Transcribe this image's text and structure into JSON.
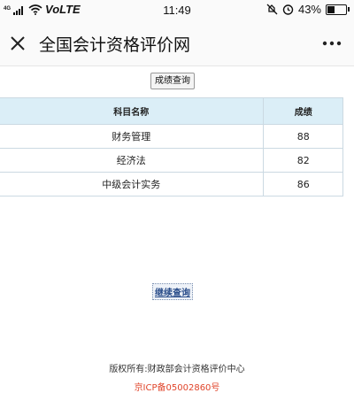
{
  "status_bar": {
    "network": "4G",
    "volte": "VoLTE",
    "time": "11:49",
    "battery_text": "43%",
    "battery_level": 0.43
  },
  "app_bar": {
    "title": "全国会计资格评价网"
  },
  "query_button": {
    "label": "成绩查询"
  },
  "score_table": {
    "headers": [
      "科目名称",
      "成绩"
    ],
    "rows": [
      [
        "财务管理",
        "88"
      ],
      [
        "经济法",
        "82"
      ],
      [
        "中级会计实务",
        "86"
      ]
    ]
  },
  "continue_link": {
    "label": "继续查询"
  },
  "footer": {
    "copyright": "版权所有:财政部会计资格评价中心",
    "icp": "京ICP备05002860号"
  },
  "colors": {
    "header_bg": "#dbeef7",
    "icp_red": "#e0442a",
    "link_blue": "#2a4d8a"
  }
}
